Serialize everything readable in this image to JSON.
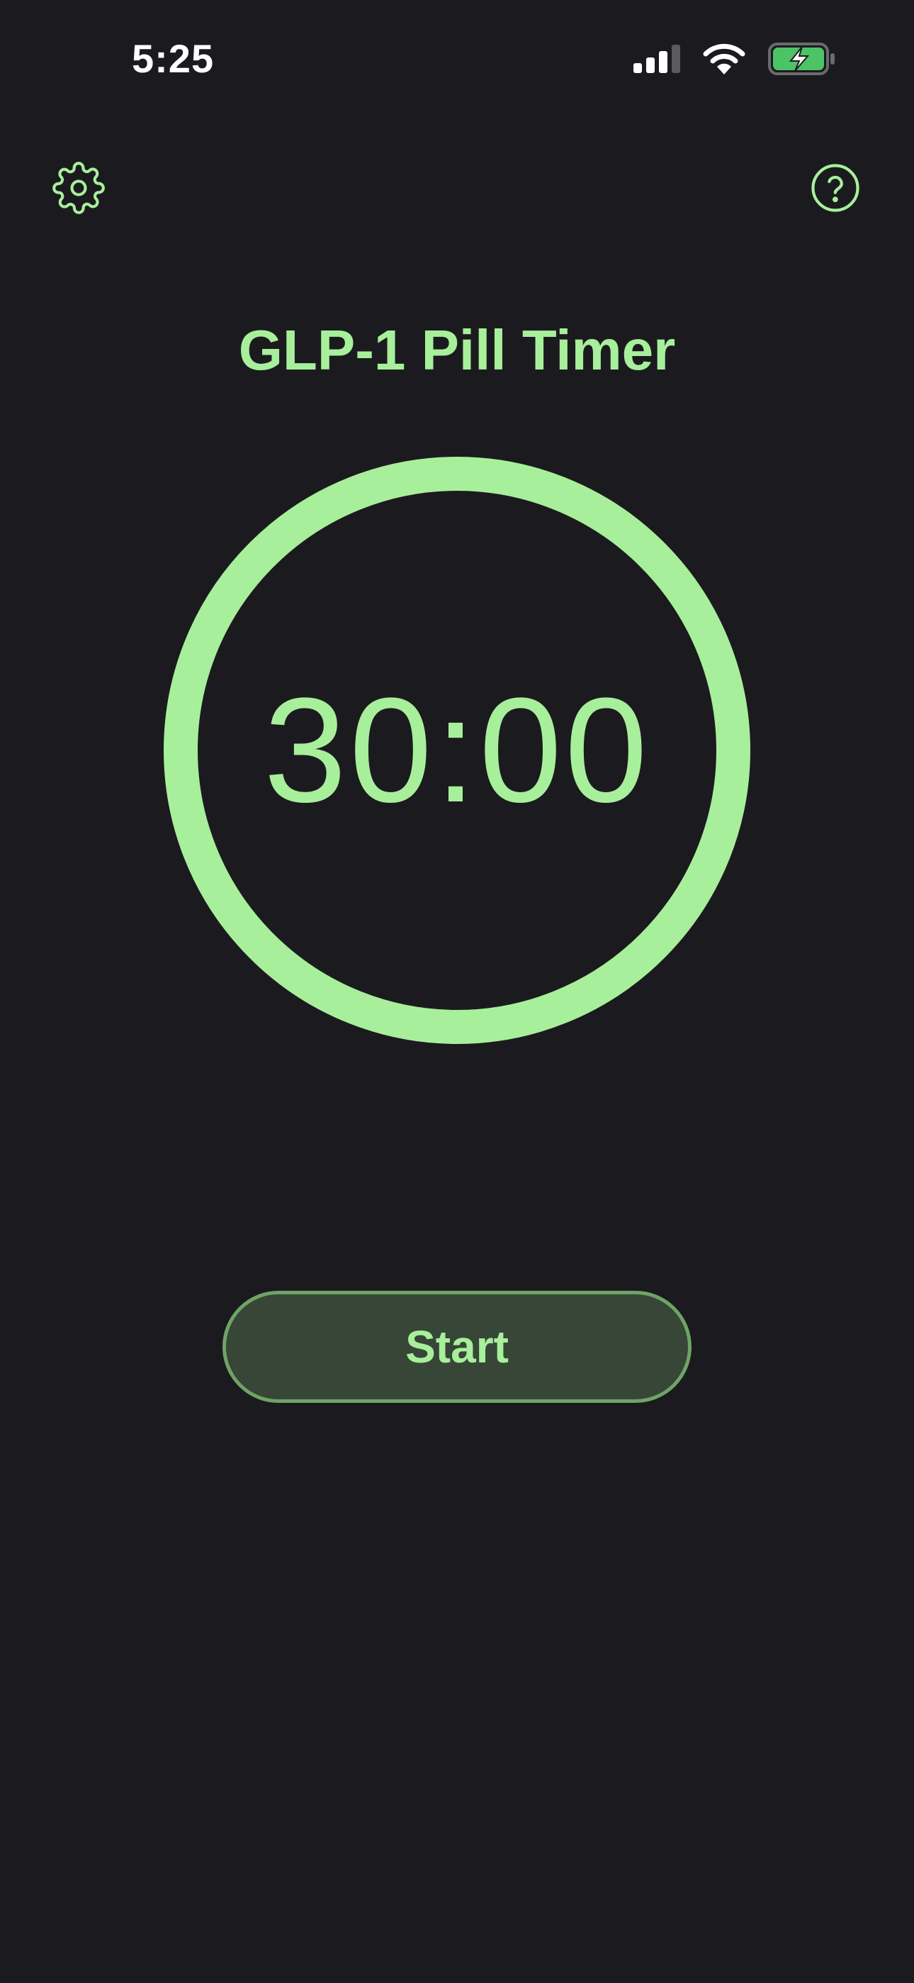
{
  "status_bar": {
    "time": "5:25",
    "icons": [
      "cellular-signal-icon",
      "wifi-icon",
      "battery-charging-icon"
    ]
  },
  "header": {
    "settings_icon": "gear-icon",
    "help_icon": "question-circle-icon"
  },
  "main": {
    "title": "GLP-1 Pill Timer",
    "timer": "30:00",
    "start_label": "Start"
  },
  "colors": {
    "background": "#1b1b1f",
    "accent": "#a8ef9b",
    "button_fill": "#374637",
    "button_border": "#6ea466",
    "battery_fill": "#4cc466"
  }
}
